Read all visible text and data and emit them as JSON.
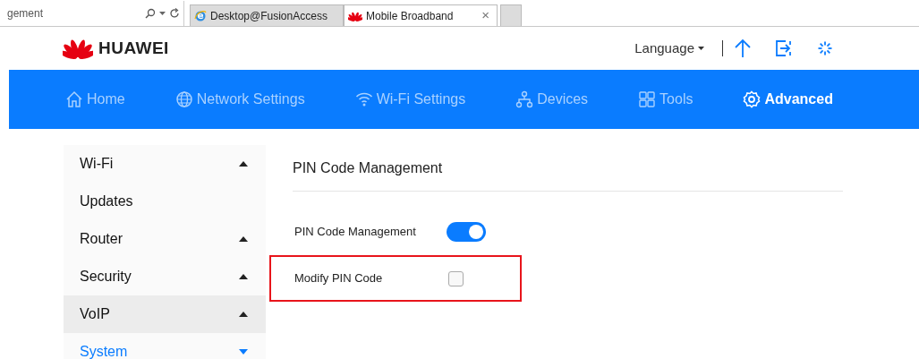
{
  "browser": {
    "address": "gement",
    "tabs": [
      {
        "label": "Desktop@FusionAccess",
        "selected": false,
        "kind": "ie"
      },
      {
        "label": "Mobile Broadband",
        "selected": true,
        "kind": "huawei"
      }
    ],
    "close": "×"
  },
  "header": {
    "brand": "HUAWEI",
    "language": "Language"
  },
  "nav": [
    {
      "label": "Home",
      "selected": false
    },
    {
      "label": "Network Settings",
      "selected": false
    },
    {
      "label": "Wi-Fi Settings",
      "selected": false
    },
    {
      "label": "Devices",
      "selected": false
    },
    {
      "label": "Tools",
      "selected": false
    },
    {
      "label": "Advanced",
      "selected": true
    }
  ],
  "sidebar": {
    "items": [
      {
        "label": "Wi-Fi",
        "expanded": false,
        "selected": false
      },
      {
        "label": "Updates",
        "selected": false
      },
      {
        "label": "Router",
        "expanded": false,
        "selected": false
      },
      {
        "label": "Security",
        "expanded": false,
        "selected": false
      },
      {
        "label": "VoIP",
        "expanded": false,
        "selected": false,
        "hovered": true
      },
      {
        "label": "System",
        "expanded": true,
        "selected": true
      }
    ]
  },
  "content": {
    "title": "PIN Code Management",
    "settings": [
      {
        "label": "PIN Code Management",
        "kind": "switch",
        "on": true,
        "highlighted": false
      },
      {
        "label": "Modify PIN Code",
        "kind": "checkbox",
        "checked": false,
        "highlighted": true
      }
    ]
  }
}
